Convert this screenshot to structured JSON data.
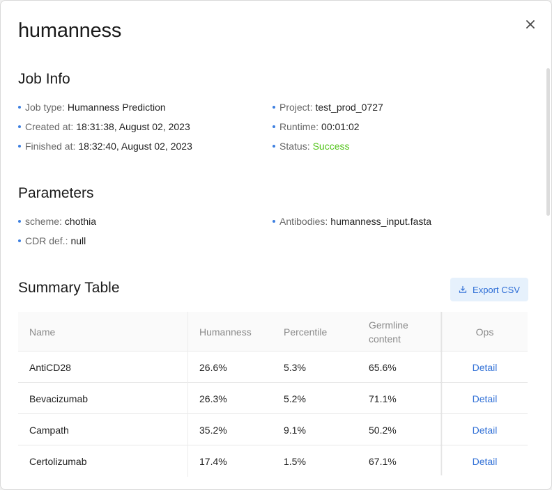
{
  "modal": {
    "title": "humanness"
  },
  "job_info": {
    "title": "Job Info",
    "items": [
      {
        "label": "Job type:",
        "value": "Humanness Prediction"
      },
      {
        "label": "Project:",
        "value": "test_prod_0727"
      },
      {
        "label": "Created at:",
        "value": "18:31:38, August 02, 2023"
      },
      {
        "label": "Runtime:",
        "value": "00:01:02"
      },
      {
        "label": "Finished at:",
        "value": "18:32:40, August 02, 2023"
      },
      {
        "label": "Status:",
        "value": "Success"
      }
    ]
  },
  "parameters": {
    "title": "Parameters",
    "items": [
      {
        "label": "scheme:",
        "value": "chothia"
      },
      {
        "label": "Antibodies:",
        "value": "humanness_input.fasta"
      },
      {
        "label": "CDR def.:",
        "value": "null"
      }
    ]
  },
  "summary": {
    "title": "Summary Table",
    "export_label": "Export CSV",
    "columns": [
      "Name",
      "Humanness",
      "Percentile",
      "Germline content",
      "Ops"
    ],
    "rows": [
      {
        "name": "AntiCD28",
        "humanness": "26.6%",
        "percentile": "5.3%",
        "germline": "65.6%",
        "op": "Detail"
      },
      {
        "name": "Bevacizumab",
        "humanness": "26.3%",
        "percentile": "5.2%",
        "germline": "71.1%",
        "op": "Detail"
      },
      {
        "name": "Campath",
        "humanness": "35.2%",
        "percentile": "9.1%",
        "germline": "50.2%",
        "op": "Detail"
      },
      {
        "name": "Certolizumab",
        "humanness": "17.4%",
        "percentile": "1.5%",
        "germline": "67.1%",
        "op": "Detail"
      }
    ]
  },
  "colors": {
    "accent": "#2f6fd6",
    "success": "#52c41a",
    "bullet": "#3d7fe0"
  }
}
